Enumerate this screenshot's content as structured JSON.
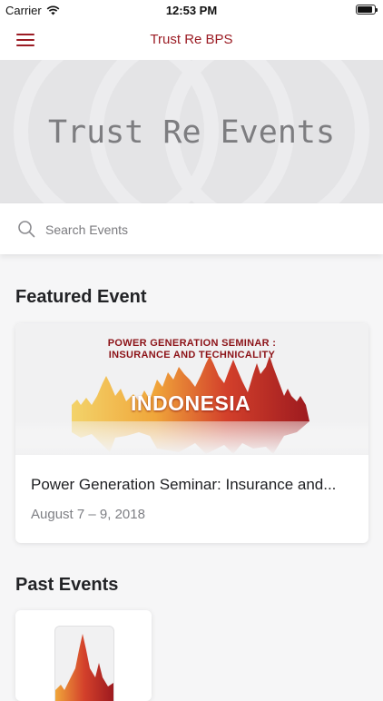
{
  "status_bar": {
    "carrier": "Carrier",
    "time": "12:53 PM",
    "battery_level": 0.9
  },
  "nav": {
    "title": "Trust Re BPS"
  },
  "hero": {
    "title": "Trust Re Events"
  },
  "search": {
    "placeholder": "Search Events",
    "value": ""
  },
  "featured": {
    "heading": "Featured Event",
    "banner": {
      "line1": "POWER GENERATION SEMINAR :",
      "line2": "INSURANCE AND TECHNICALITY",
      "country": "INDONESIA"
    },
    "title": "Power Generation Seminar: Insurance and...",
    "date": "August 7 – 9, 2018"
  },
  "past": {
    "heading": "Past Events"
  },
  "colors": {
    "accent": "#9b1c24",
    "hero_bg": "#e4e4e6",
    "page_bg": "#f6f6f7"
  },
  "icons": {
    "menu": "hamburger-icon",
    "search": "search-icon",
    "wifi": "wifi-icon",
    "battery": "battery-icon"
  }
}
